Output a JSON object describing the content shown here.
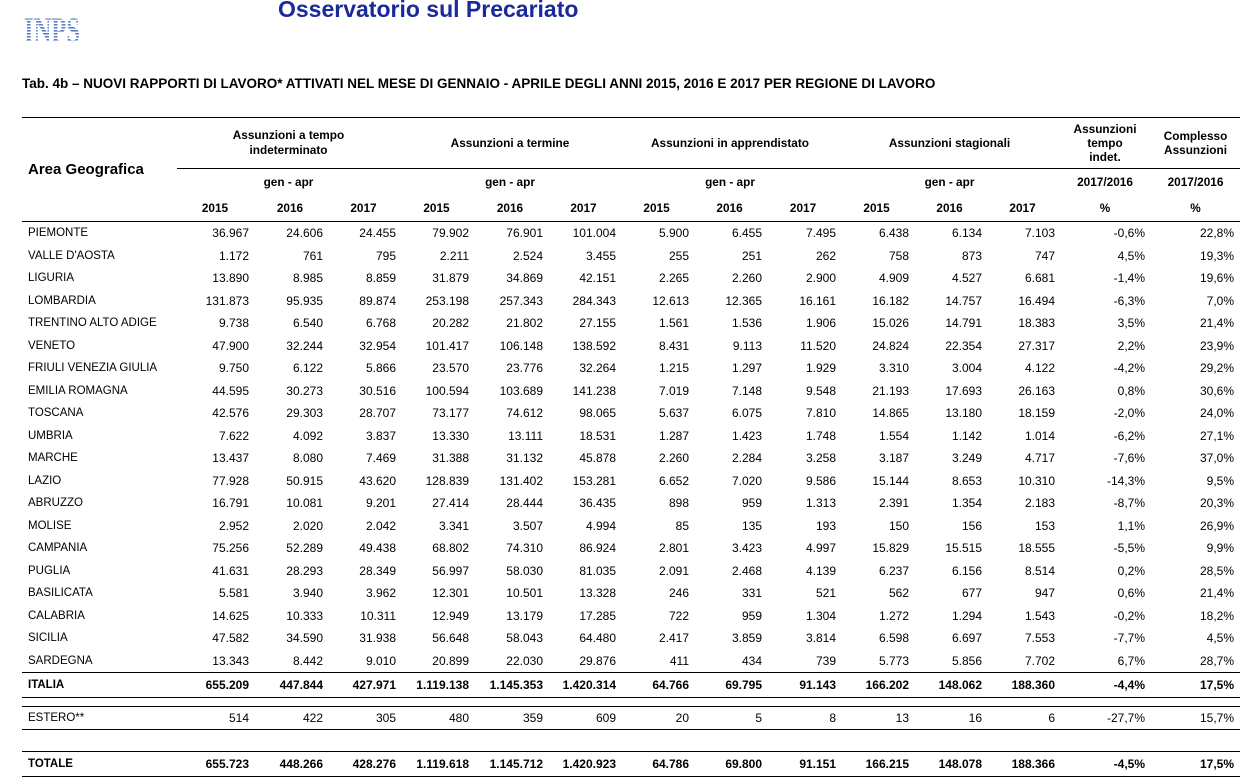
{
  "header": {
    "logo_text": "INPS",
    "title": "Osservatorio sul Precariato",
    "caption": "Tab. 4b – NUOVI RAPPORTI DI LAVORO* ATTIVATI NEL MESE DI GENNAIO - APRILE DEGLI ANNI 2015, 2016 E 2017 PER REGIONE DI LAVORO"
  },
  "colors": {
    "title": "#1a2a9a",
    "logo": "#5a7fc0"
  },
  "table": {
    "area_header": "Area Geografica",
    "groups": [
      {
        "label": "Assunzioni a tempo indeterminato",
        "period": "gen - apr"
      },
      {
        "label": "Assunzioni a termine",
        "period": "gen - apr"
      },
      {
        "label": "Assunzioni in apprendistato",
        "period": "gen - apr"
      },
      {
        "label": "Assunzioni stagionali",
        "period": "gen - apr"
      }
    ],
    "var1": {
      "label": "Assunzioni tempo indet.",
      "period": "2017/2016",
      "unit": "%"
    },
    "var2": {
      "label": "Complesso Assunzioni",
      "period": "2017/2016",
      "unit": "%"
    },
    "years": [
      "2015",
      "2016",
      "2017"
    ],
    "rows": [
      {
        "name": "PIEMONTE",
        "v": [
          "36.967",
          "24.606",
          "24.455",
          "79.902",
          "76.901",
          "101.004",
          "5.900",
          "6.455",
          "7.495",
          "6.438",
          "6.134",
          "7.103",
          "-0,6%",
          "22,8%"
        ]
      },
      {
        "name": "VALLE D'AOSTA",
        "v": [
          "1.172",
          "761",
          "795",
          "2.211",
          "2.524",
          "3.455",
          "255",
          "251",
          "262",
          "758",
          "873",
          "747",
          "4,5%",
          "19,3%"
        ]
      },
      {
        "name": "LIGURIA",
        "v": [
          "13.890",
          "8.985",
          "8.859",
          "31.879",
          "34.869",
          "42.151",
          "2.265",
          "2.260",
          "2.900",
          "4.909",
          "4.527",
          "6.681",
          "-1,4%",
          "19,6%"
        ]
      },
      {
        "name": "LOMBARDIA",
        "v": [
          "131.873",
          "95.935",
          "89.874",
          "253.198",
          "257.343",
          "284.343",
          "12.613",
          "12.365",
          "16.161",
          "16.182",
          "14.757",
          "16.494",
          "-6,3%",
          "7,0%"
        ]
      },
      {
        "name": "TRENTINO ALTO ADIGE",
        "v": [
          "9.738",
          "6.540",
          "6.768",
          "20.282",
          "21.802",
          "27.155",
          "1.561",
          "1.536",
          "1.906",
          "15.026",
          "14.791",
          "18.383",
          "3,5%",
          "21,4%"
        ]
      },
      {
        "name": "VENETO",
        "v": [
          "47.900",
          "32.244",
          "32.954",
          "101.417",
          "106.148",
          "138.592",
          "8.431",
          "9.113",
          "11.520",
          "24.824",
          "22.354",
          "27.317",
          "2,2%",
          "23,9%"
        ]
      },
      {
        "name": "FRIULI VENEZIA GIULIA",
        "v": [
          "9.750",
          "6.122",
          "5.866",
          "23.570",
          "23.776",
          "32.264",
          "1.215",
          "1.297",
          "1.929",
          "3.310",
          "3.004",
          "4.122",
          "-4,2%",
          "29,2%"
        ]
      },
      {
        "name": "EMILIA ROMAGNA",
        "v": [
          "44.595",
          "30.273",
          "30.516",
          "100.594",
          "103.689",
          "141.238",
          "7.019",
          "7.148",
          "9.548",
          "21.193",
          "17.693",
          "26.163",
          "0,8%",
          "30,6%"
        ]
      },
      {
        "name": "TOSCANA",
        "v": [
          "42.576",
          "29.303",
          "28.707",
          "73.177",
          "74.612",
          "98.065",
          "5.637",
          "6.075",
          "7.810",
          "14.865",
          "13.180",
          "18.159",
          "-2,0%",
          "24,0%"
        ]
      },
      {
        "name": "UMBRIA",
        "v": [
          "7.622",
          "4.092",
          "3.837",
          "13.330",
          "13.111",
          "18.531",
          "1.287",
          "1.423",
          "1.748",
          "1.554",
          "1.142",
          "1.014",
          "-6,2%",
          "27,1%"
        ]
      },
      {
        "name": "MARCHE",
        "v": [
          "13.437",
          "8.080",
          "7.469",
          "31.388",
          "31.132",
          "45.878",
          "2.260",
          "2.284",
          "3.258",
          "3.187",
          "3.249",
          "4.717",
          "-7,6%",
          "37,0%"
        ]
      },
      {
        "name": "LAZIO",
        "v": [
          "77.928",
          "50.915",
          "43.620",
          "128.839",
          "131.402",
          "153.281",
          "6.652",
          "7.020",
          "9.586",
          "15.144",
          "8.653",
          "10.310",
          "-14,3%",
          "9,5%"
        ]
      },
      {
        "name": "ABRUZZO",
        "v": [
          "16.791",
          "10.081",
          "9.201",
          "27.414",
          "28.444",
          "36.435",
          "898",
          "959",
          "1.313",
          "2.391",
          "1.354",
          "2.183",
          "-8,7%",
          "20,3%"
        ]
      },
      {
        "name": "MOLISE",
        "v": [
          "2.952",
          "2.020",
          "2.042",
          "3.341",
          "3.507",
          "4.994",
          "85",
          "135",
          "193",
          "150",
          "156",
          "153",
          "1,1%",
          "26,9%"
        ]
      },
      {
        "name": "CAMPANIA",
        "v": [
          "75.256",
          "52.289",
          "49.438",
          "68.802",
          "74.310",
          "86.924",
          "2.801",
          "3.423",
          "4.997",
          "15.829",
          "15.515",
          "18.555",
          "-5,5%",
          "9,9%"
        ]
      },
      {
        "name": "PUGLIA",
        "v": [
          "41.631",
          "28.293",
          "28.349",
          "56.997",
          "58.030",
          "81.035",
          "2.091",
          "2.468",
          "4.139",
          "6.237",
          "6.156",
          "8.514",
          "0,2%",
          "28,5%"
        ]
      },
      {
        "name": "BASILICATA",
        "v": [
          "5.581",
          "3.940",
          "3.962",
          "12.301",
          "10.501",
          "13.328",
          "246",
          "331",
          "521",
          "562",
          "677",
          "947",
          "0,6%",
          "21,4%"
        ]
      },
      {
        "name": "CALABRIA",
        "v": [
          "14.625",
          "10.333",
          "10.311",
          "12.949",
          "13.179",
          "17.285",
          "722",
          "959",
          "1.304",
          "1.272",
          "1.294",
          "1.543",
          "-0,2%",
          "18,2%"
        ]
      },
      {
        "name": "SICILIA",
        "v": [
          "47.582",
          "34.590",
          "31.938",
          "56.648",
          "58.043",
          "64.480",
          "2.417",
          "3.859",
          "3.814",
          "6.598",
          "6.697",
          "7.553",
          "-7,7%",
          "4,5%"
        ]
      },
      {
        "name": "SARDEGNA",
        "v": [
          "13.343",
          "8.442",
          "9.010",
          "20.899",
          "22.030",
          "29.876",
          "411",
          "434",
          "739",
          "5.773",
          "5.856",
          "7.702",
          "6,7%",
          "28,7%"
        ]
      }
    ],
    "italia": {
      "name": "ITALIA",
      "v": [
        "655.209",
        "447.844",
        "427.971",
        "1.119.138",
        "1.145.353",
        "1.420.314",
        "64.766",
        "69.795",
        "91.143",
        "166.202",
        "148.062",
        "188.360",
        "-4,4%",
        "17,5%"
      ]
    },
    "estero": {
      "name": "ESTERO**",
      "v": [
        "514",
        "422",
        "305",
        "480",
        "359",
        "609",
        "20",
        "5",
        "8",
        "13",
        "16",
        "6",
        "-27,7%",
        "15,7%"
      ]
    },
    "totale": {
      "name": "TOTALE",
      "v": [
        "655.723",
        "448.266",
        "428.276",
        "1.119.618",
        "1.145.712",
        "1.420.923",
        "64.786",
        "69.800",
        "91.151",
        "166.215",
        "148.078",
        "188.366",
        "-4,5%",
        "17,5%"
      ]
    }
  }
}
